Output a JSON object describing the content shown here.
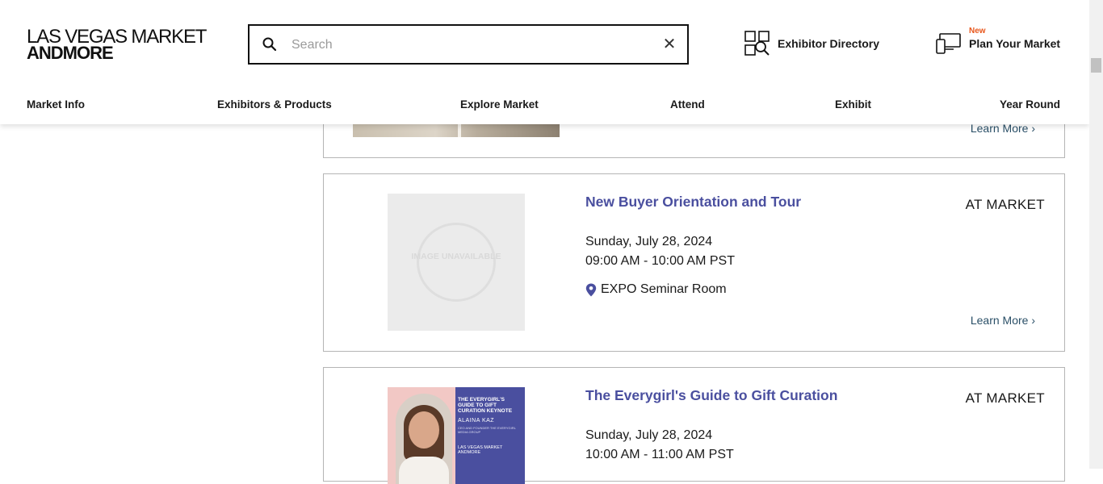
{
  "logo": {
    "line1": "LAS VEGAS MARKET",
    "line2": "ANDMORE"
  },
  "search": {
    "placeholder": "Search",
    "value": ""
  },
  "header_links": {
    "directory": "Exhibitor Directory",
    "plan_badge": "New",
    "plan": "Plan Your Market"
  },
  "nav": [
    "Market Info",
    "Exhibitors & Products",
    "Explore Market",
    "Attend",
    "Exhibit",
    "Year Round"
  ],
  "events": [
    {
      "learn_more": "Learn More"
    },
    {
      "title": "New Buyer Orientation and Tour",
      "badge": "AT MARKET",
      "date": "Sunday, July 28, 2024",
      "time": "09:00 AM - 10:00 AM PST",
      "location": "EXPO Seminar Room",
      "image_text": "IMAGE UNAVAILABLE",
      "learn_more": "Learn More"
    },
    {
      "title": "The Everygirl's Guide to Gift Curation",
      "badge": "AT MARKET",
      "date": "Sunday, July 28, 2024",
      "time": "10:00 AM - 11:00 AM PST",
      "promo": {
        "title": "THE EVERYGIRL'S GUIDE TO GIFT CURATION KEYNOTE",
        "name": "ALAINA KAZ",
        "subtitle": "CEO AND FOUNDER THE EVERYGIRL MEDIA GROUP",
        "logo": "LAS VEGAS MARKET ANDMORE"
      }
    }
  ],
  "colors": {
    "accent": "#4a4f9f",
    "new_badge": "#e8561b",
    "link": "#2a4f67",
    "border": "#b5b5b5"
  }
}
